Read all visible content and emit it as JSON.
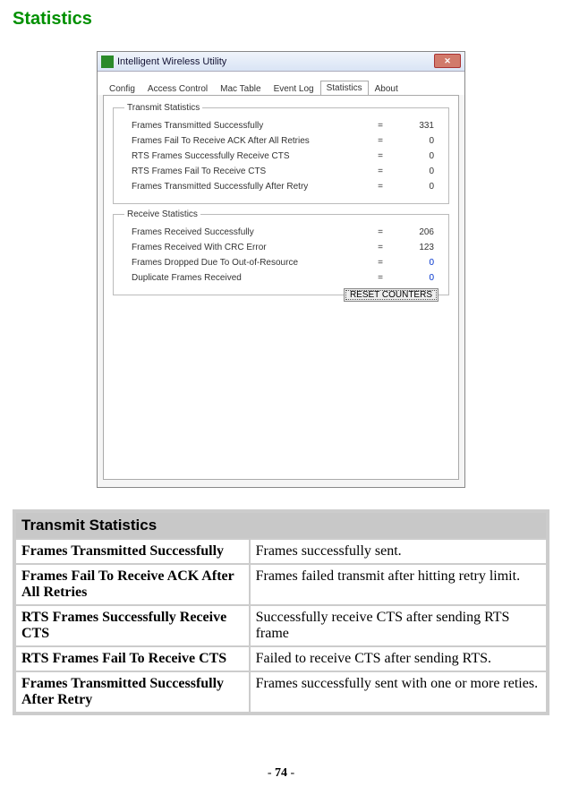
{
  "page_title": "Statistics",
  "dialog": {
    "title": "Intelligent Wireless Utility",
    "tabs": [
      "Config",
      "Access Control",
      "Mac Table",
      "Event Log",
      "Statistics",
      "About"
    ],
    "selected_tab": "Statistics",
    "transmit": {
      "legend": "Transmit Statistics",
      "rows": [
        {
          "label": "Frames Transmitted Successfully",
          "eq": "=",
          "val": "331"
        },
        {
          "label": "Frames Fail To Receive ACK After All Retries",
          "eq": "=",
          "val": "0"
        },
        {
          "label": "RTS Frames Successfully Receive CTS",
          "eq": "=",
          "val": "0"
        },
        {
          "label": "RTS Frames Fail To Receive CTS",
          "eq": "=",
          "val": "0"
        },
        {
          "label": "Frames Transmitted Successfully After Retry",
          "eq": "=",
          "val": "0"
        }
      ]
    },
    "receive": {
      "legend": "Receive Statistics",
      "rows": [
        {
          "label": "Frames Received Successfully",
          "eq": "=",
          "val": "206"
        },
        {
          "label": "Frames Received With CRC Error",
          "eq": "=",
          "val": "123"
        },
        {
          "label": "Frames Dropped Due To Out-of-Resource",
          "eq": "=",
          "val": "0",
          "blue": true
        },
        {
          "label": "Duplicate Frames Received",
          "eq": "=",
          "val": "0",
          "blue": true
        }
      ]
    },
    "reset_label": "RESET COUNTERS"
  },
  "table": {
    "section": "Transmit Statistics",
    "rows": [
      {
        "l": "Frames Transmitted Successfully",
        "r": "Frames successfully sent."
      },
      {
        "l": "Frames Fail To Receive ACK After All Retries",
        "r": "Frames failed transmit after hitting retry limit."
      },
      {
        "l": "RTS Frames Successfully Receive CTS",
        "r": "Successfully receive CTS after sending RTS frame"
      },
      {
        "l": "RTS Frames Fail To Receive CTS",
        "r": "Failed to receive CTS after sending RTS."
      },
      {
        "l": "Frames Transmitted Successfully After Retry",
        "r": "Frames successfully sent with one or more reties."
      }
    ]
  },
  "page_number": "74"
}
